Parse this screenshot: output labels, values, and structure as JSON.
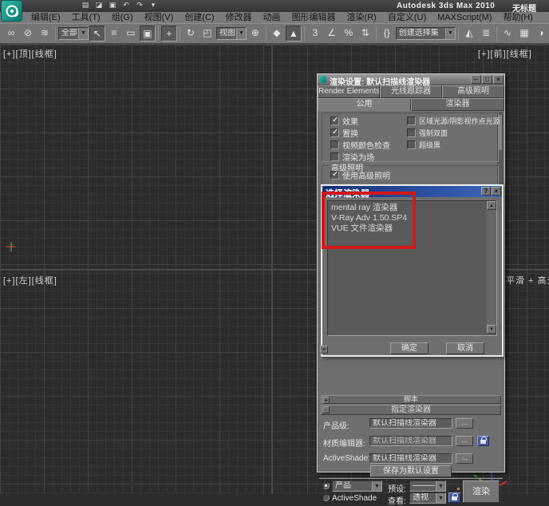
{
  "window": {
    "app_title": "Autodesk 3ds Max  2010",
    "doc_title": "无标题",
    "quick_access": [
      {
        "name": "new-scene-icon",
        "glyph": "▤"
      },
      {
        "name": "open-file-icon",
        "glyph": "◪"
      },
      {
        "name": "save-file-icon",
        "glyph": "▣"
      },
      {
        "name": "undo-icon",
        "glyph": "↶"
      },
      {
        "name": "redo-icon",
        "glyph": "↷"
      },
      {
        "name": "quick-access-more-icon",
        "glyph": "▾"
      }
    ]
  },
  "menu": {
    "items": [
      "编辑(E)",
      "工具(T)",
      "组(G)",
      "视图(V)",
      "创建(C)",
      "修改器",
      "动画",
      "图形编辑器",
      "渲染(R)",
      "自定义(U)",
      "MAXScript(M)",
      "帮助(H)"
    ]
  },
  "toolbar": {
    "g1": [
      {
        "name": "select-and-link-icon",
        "glyph": "∞"
      },
      {
        "name": "unlink-selection-icon",
        "glyph": "⊘"
      },
      {
        "name": "bind-to-space-warp-icon",
        "glyph": "≋"
      }
    ],
    "filter_dropdown": "全部",
    "g2": [
      {
        "name": "select-object-icon",
        "glyph": "↖",
        "pressed": true
      },
      {
        "name": "select-by-name-icon",
        "glyph": "≡"
      },
      {
        "name": "rectangular-selection-icon",
        "glyph": "▭"
      },
      {
        "name": "window-crossing-icon",
        "glyph": "▣",
        "pressed": true
      }
    ],
    "g3": [
      {
        "name": "select-and-move-icon",
        "glyph": "+",
        "pressed": true
      }
    ],
    "g4": [
      {
        "name": "select-and-rotate-icon",
        "glyph": "↻"
      },
      {
        "name": "select-and-scale-icon",
        "glyph": "◰"
      }
    ],
    "coord_dropdown": "视图",
    "g5": [
      {
        "name": "use-pivot-center-icon",
        "glyph": "⊕"
      }
    ],
    "g6": [
      {
        "name": "select-and-manipulate-icon",
        "glyph": "◆"
      },
      {
        "name": "keyboard-override-icon",
        "glyph": "▲",
        "pressed": true
      }
    ],
    "g7": [
      {
        "name": "snap-toggle-3d-icon",
        "glyph": "3"
      },
      {
        "name": "angle-snap-icon",
        "glyph": "∠"
      },
      {
        "name": "percent-snap-icon",
        "glyph": "%"
      },
      {
        "name": "spinner-snap-icon",
        "glyph": "⇅"
      }
    ],
    "g8": [
      {
        "name": "edit-named-selections-icon",
        "glyph": "{}"
      }
    ],
    "selset_dropdown": "创建选择集",
    "g9": [
      {
        "name": "mirror-icon",
        "glyph": "◭"
      },
      {
        "name": "align-icon",
        "glyph": "≣"
      }
    ],
    "g10": [
      {
        "name": "curve-editor-icon",
        "glyph": "∿"
      },
      {
        "name": "schematic-view-icon",
        "glyph": "▦"
      },
      {
        "name": "material-editor-icon",
        "glyph": "◑"
      }
    ]
  },
  "viewports": {
    "top_left_label": "[+][顶][线框]",
    "top_right_label": "[+][前][线框]",
    "bottom_left_label": "[+][左][线框]",
    "bottom_right_label": "平滑 + 高光 ]"
  },
  "render_dialog": {
    "title": "渲染设置: 默认扫描线渲染器",
    "buttons": {
      "min": "─",
      "max": "□",
      "close": "×"
    },
    "tabs_row1": [
      {
        "label": "Render Elements"
      },
      {
        "label": "光线跟踪器"
      },
      {
        "label": "高级照明"
      }
    ],
    "tabs_row2": [
      {
        "label": "公用",
        "active": true
      },
      {
        "label": "渲染器"
      }
    ],
    "options_col1": [
      {
        "label": "效果",
        "checked": true
      },
      {
        "label": "置换",
        "checked": true
      },
      {
        "label": "视频颜色检查",
        "checked": false
      },
      {
        "label": "渲染为场",
        "checked": false
      }
    ],
    "options_col2": [
      {
        "label": "区域光源/阴影视作点光源",
        "checked": false
      },
      {
        "label": "强制双面",
        "checked": false
      },
      {
        "label": "超级黑",
        "checked": false
      }
    ],
    "advanced_lighting": {
      "group_label": "高级照明",
      "use_label": "使用高级照明",
      "checked": true
    },
    "rollout_script": "脚本",
    "rollout_script_toggle": "+",
    "rollout_assign": "指定渲染器",
    "rollout_assign_toggle": "-",
    "stray_rollout_toggle": "+",
    "assign": {
      "production_label": "产品级:",
      "production_value": "默认扫描线渲染器",
      "material_label": "材质编辑器:",
      "material_value": "默认扫描线渲染器",
      "activeshade_label": "ActiveShade:",
      "activeshade_value": "默认扫描线渲染器",
      "browse": "...",
      "save_defaults": "保存为默认设置"
    },
    "footer": {
      "mode_production": "产品",
      "mode_activeshade": "ActiveShade",
      "preset_label": "预设:",
      "preset_value": "—————",
      "view_label": "查看:",
      "view_value": "透视",
      "render_button": "渲染"
    }
  },
  "choose_renderer_dialog": {
    "title": "选择渲染器",
    "help": "?",
    "close": "×",
    "items": [
      "mental ray 渲染器",
      "V-Ray Adv 1.50.SP4",
      "VUE 文件渲染器"
    ],
    "ok": "确定",
    "cancel": "取消",
    "scroll_up": "▲",
    "scroll_down": "▼"
  },
  "colors": {
    "highlight_red": "#d31717",
    "dialog_title_blue": "#122d75",
    "logo_teal": "#1a9488"
  }
}
